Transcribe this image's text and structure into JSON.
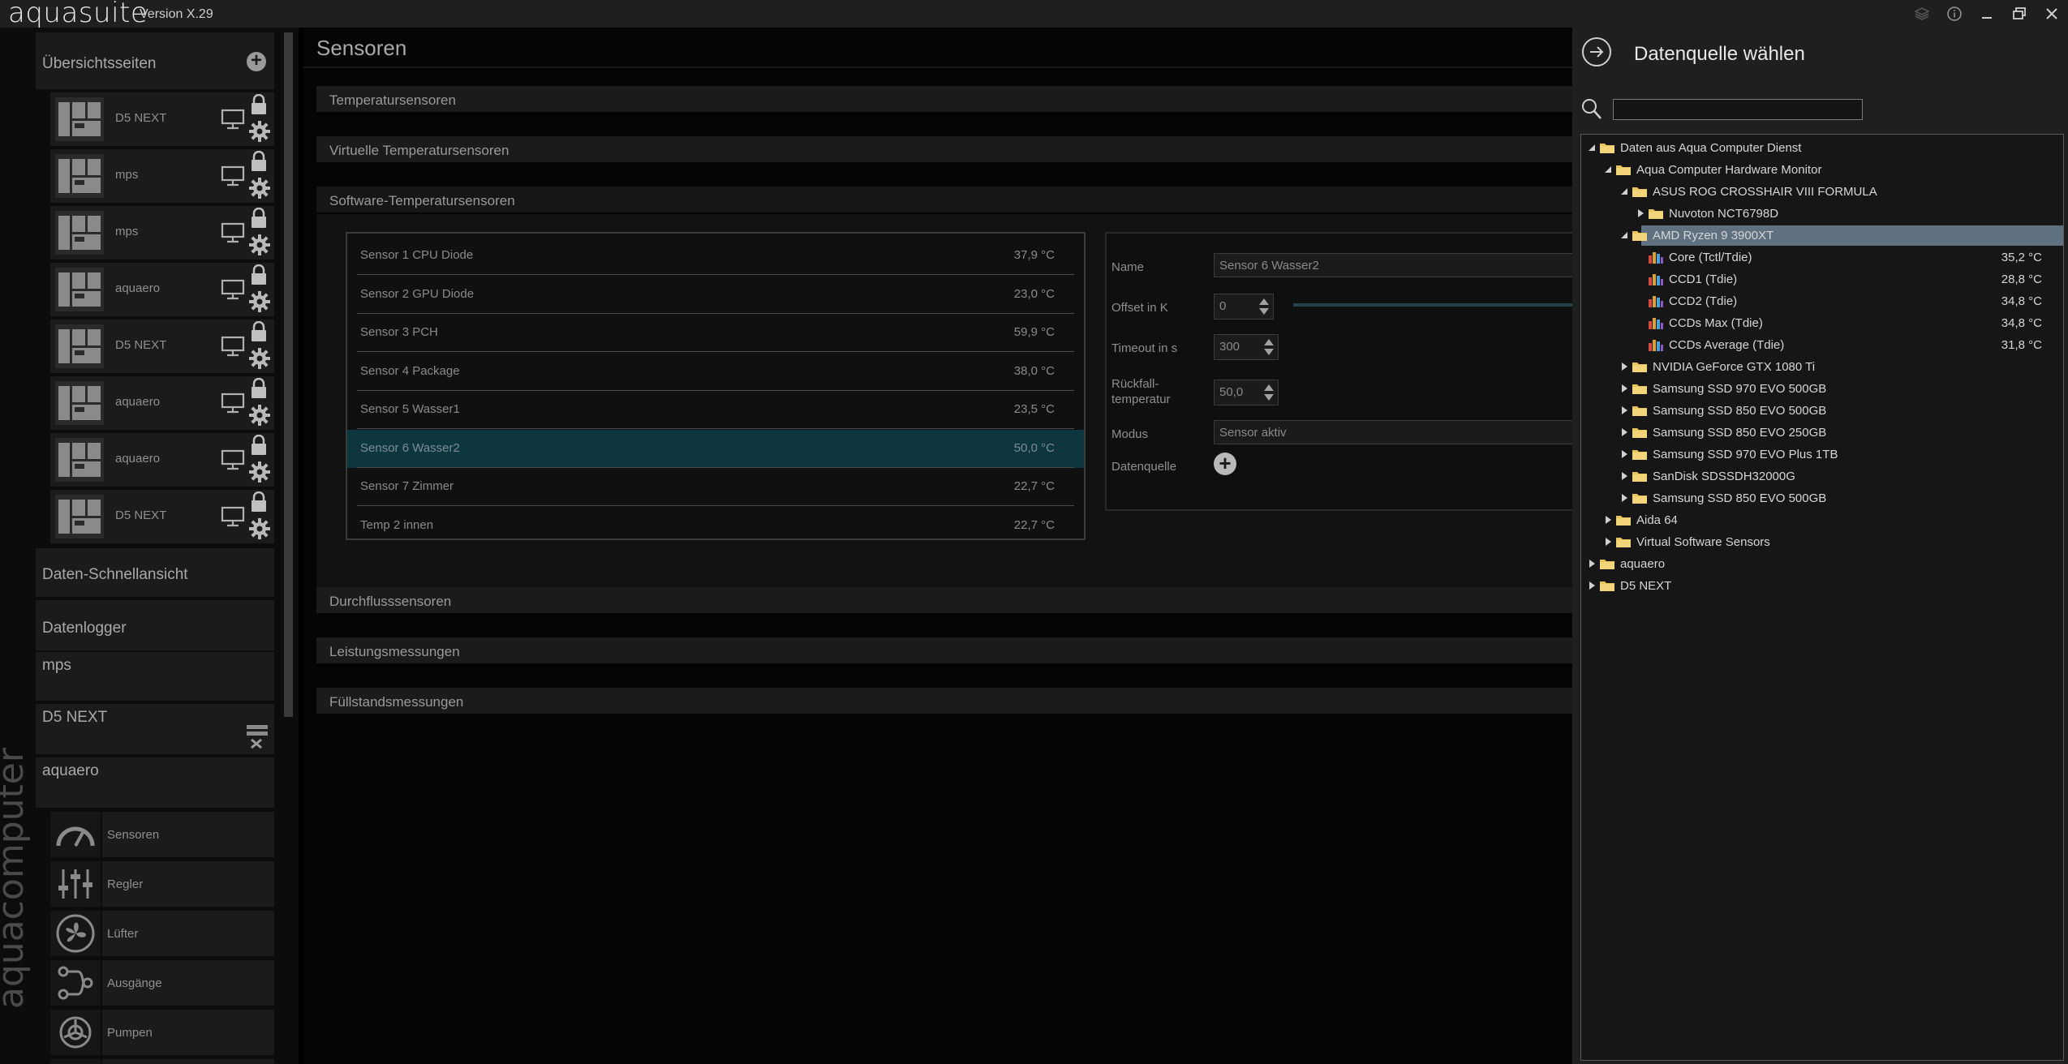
{
  "app": {
    "logo": "aquasuite",
    "version": "Version X.29",
    "vertical_brand": "aquacomputer"
  },
  "sidebar": {
    "overview_title": "Übersichtsseiten",
    "pages": [
      {
        "label": "D5 NEXT"
      },
      {
        "label": "mps"
      },
      {
        "label": "mps"
      },
      {
        "label": "aquaero"
      },
      {
        "label": "D5 NEXT"
      },
      {
        "label": "aquaero"
      },
      {
        "label": "aquaero"
      },
      {
        "label": "D5 NEXT"
      }
    ],
    "sections": [
      "Daten-Schnellansicht",
      "Datenlogger",
      "mps",
      "D5 NEXT",
      "aquaero"
    ],
    "sub_items": [
      "Sensoren",
      "Regler",
      "Lüfter",
      "Ausgänge",
      "Pumpen"
    ]
  },
  "main": {
    "title": "Sensoren",
    "sections": {
      "temp": "Temperatursensoren",
      "virtual": "Virtuelle Temperatursensoren",
      "software": "Software-Temperatursensoren",
      "flow": "Durchflusssensoren",
      "power": "Leistungsmessungen",
      "level": "Füllstandsmessungen"
    },
    "sensors": [
      {
        "label": "Sensor 1 CPU Diode",
        "value": "37,9 °C"
      },
      {
        "label": "Sensor 2 GPU Diode",
        "value": "23,0 °C"
      },
      {
        "label": "Sensor 3 PCH",
        "value": "59,9 °C"
      },
      {
        "label": "Sensor 4 Package",
        "value": "38,0 °C"
      },
      {
        "label": "Sensor 5 Wasser1",
        "value": "23,5 °C"
      },
      {
        "label": "Sensor 6 Wasser2",
        "value": "50,0 °C"
      },
      {
        "label": "Sensor 7  Zimmer",
        "value": "22,7 °C"
      },
      {
        "label": "Temp 2 innen",
        "value": "22,7 °C"
      }
    ],
    "selected_sensor_index": 5,
    "detail": {
      "name_label": "Name",
      "name_value": "Sensor 6 Wasser2",
      "offset_label": "Offset in K",
      "offset_value": "0",
      "timeout_label": "Timeout in s",
      "timeout_value": "300",
      "fallback_label_1": "Rückfall-",
      "fallback_label_2": "temperatur",
      "fallback_value": "50,0",
      "mode_label": "Modus",
      "mode_value": "Sensor aktiv",
      "source_label": "Datenquelle"
    }
  },
  "panel": {
    "title": "Datenquelle wählen",
    "search_value": "",
    "tree": [
      {
        "label": "Daten aus Aqua Computer Dienst",
        "depth": 0,
        "state": "expanded",
        "icon": "folder"
      },
      {
        "label": "Aqua Computer Hardware Monitor",
        "depth": 1,
        "state": "expanded",
        "icon": "folder"
      },
      {
        "label": "ASUS ROG CROSSHAIR VIII FORMULA",
        "depth": 2,
        "state": "expanded",
        "icon": "folder"
      },
      {
        "label": "Nuvoton NCT6798D",
        "depth": 3,
        "state": "collapsed",
        "icon": "folder"
      },
      {
        "label": "AMD Ryzen 9 3900XT",
        "depth": 2,
        "state": "expanded",
        "icon": "folder",
        "selected": true
      },
      {
        "label": "Core (Tctl/Tdie)",
        "depth": 3,
        "state": "leaf",
        "icon": "sensor",
        "value": "35,2 °C"
      },
      {
        "label": "CCD1 (Tdie)",
        "depth": 3,
        "state": "leaf",
        "icon": "sensor",
        "value": "28,8 °C"
      },
      {
        "label": "CCD2 (Tdie)",
        "depth": 3,
        "state": "leaf",
        "icon": "sensor",
        "value": "34,8 °C"
      },
      {
        "label": "CCDs Max (Tdie)",
        "depth": 3,
        "state": "leaf",
        "icon": "sensor",
        "value": "34,8 °C"
      },
      {
        "label": "CCDs Average (Tdie)",
        "depth": 3,
        "state": "leaf",
        "icon": "sensor",
        "value": "31,8 °C"
      },
      {
        "label": "NVIDIA GeForce GTX 1080 Ti",
        "depth": 2,
        "state": "collapsed",
        "icon": "folder"
      },
      {
        "label": "Samsung SSD 970 EVO 500GB",
        "depth": 2,
        "state": "collapsed",
        "icon": "folder"
      },
      {
        "label": "Samsung SSD 850 EVO 500GB",
        "depth": 2,
        "state": "collapsed",
        "icon": "folder"
      },
      {
        "label": "Samsung SSD 850 EVO 250GB",
        "depth": 2,
        "state": "collapsed",
        "icon": "folder"
      },
      {
        "label": "Samsung SSD 970 EVO Plus 1TB",
        "depth": 2,
        "state": "collapsed",
        "icon": "folder"
      },
      {
        "label": "SanDisk SDSSDH32000G",
        "depth": 2,
        "state": "collapsed",
        "icon": "folder"
      },
      {
        "label": "Samsung SSD 850 EVO 500GB",
        "depth": 2,
        "state": "collapsed",
        "icon": "folder"
      },
      {
        "label": "Aida 64",
        "depth": 1,
        "state": "collapsed",
        "icon": "folder"
      },
      {
        "label": "Virtual Software Sensors",
        "depth": 1,
        "state": "collapsed",
        "icon": "folder"
      },
      {
        "label": "aquaero",
        "depth": 0,
        "state": "collapsed",
        "icon": "folder"
      },
      {
        "label": "D5 NEXT",
        "depth": 0,
        "state": "collapsed",
        "icon": "folder"
      }
    ]
  },
  "colors": {
    "background": "#000000",
    "panel": "#1b1b1b",
    "selected_row": "#0e3640",
    "tree_selection": "#5f7180",
    "folder": "#e8c45a"
  }
}
